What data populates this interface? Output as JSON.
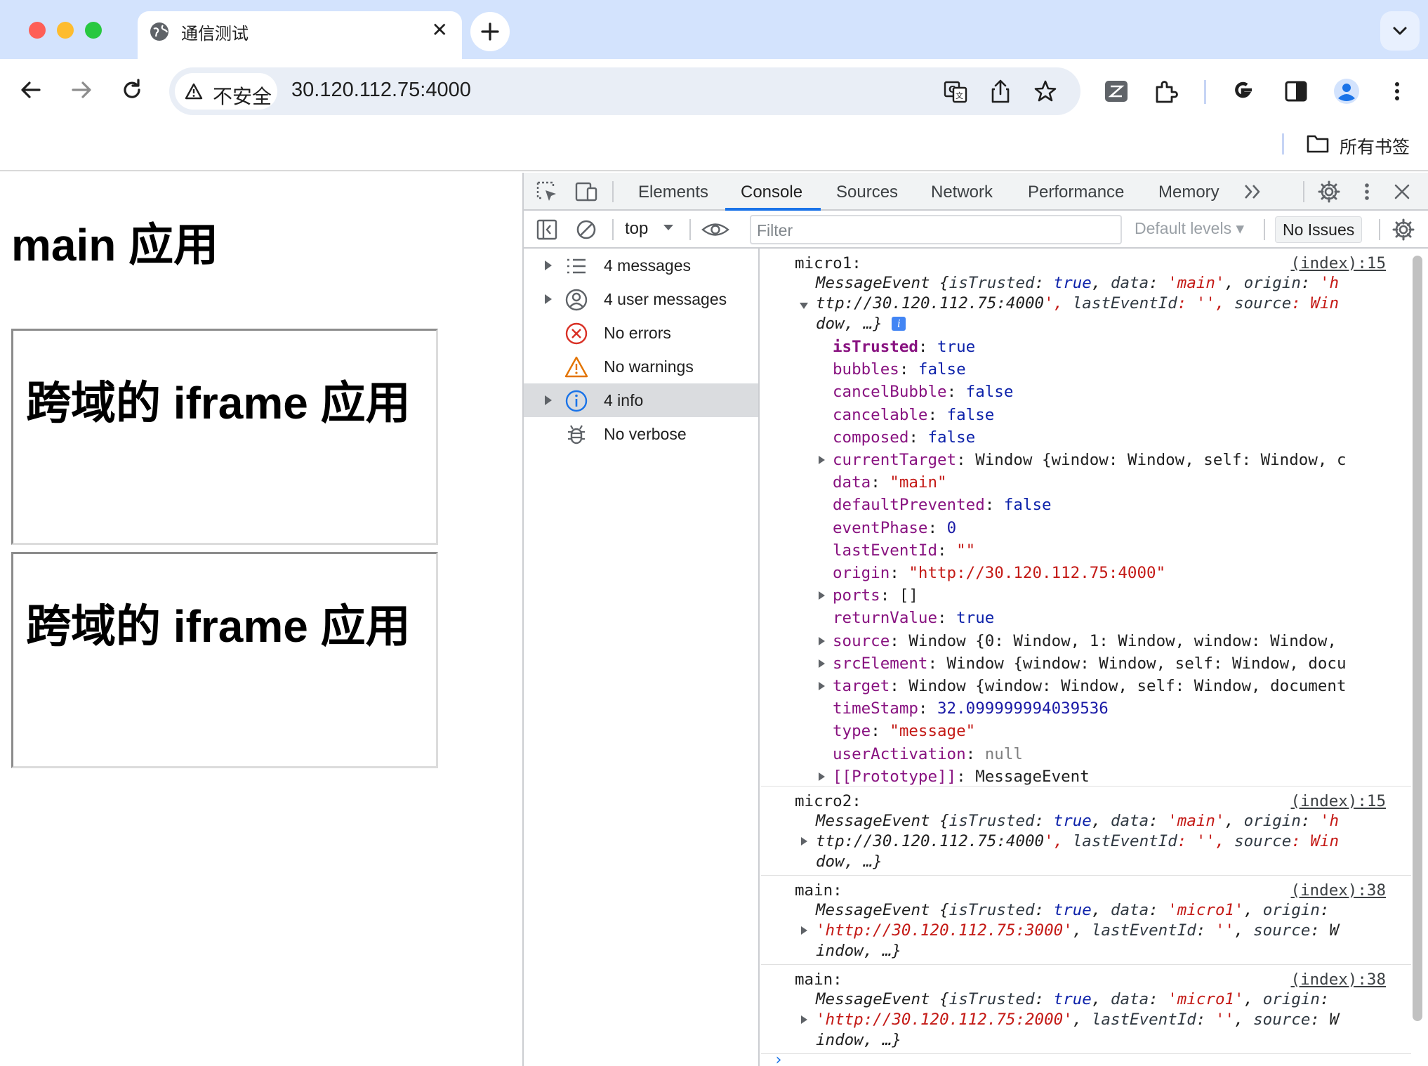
{
  "browser": {
    "tab_title": "通信测试",
    "tab_close": "✕",
    "security_chip": "不安全",
    "url": "30.120.112.75:4000",
    "bookmarks_all": "所有书签"
  },
  "page": {
    "title": "main 应用",
    "iframes": [
      "跨域的 iframe 应用",
      "跨域的 iframe 应用"
    ]
  },
  "devtools": {
    "tabs": [
      "Elements",
      "Console",
      "Sources",
      "Network",
      "Performance",
      "Memory"
    ],
    "active_tab": "Console",
    "context": "top",
    "filter_placeholder": "Filter",
    "levels": "Default levels",
    "issues": "No Issues",
    "sidebar": [
      {
        "label": "4 messages",
        "icon": "list-icon",
        "expandable": true
      },
      {
        "label": "4 user messages",
        "icon": "user-icon",
        "expandable": true
      },
      {
        "label": "No errors",
        "icon": "error-icon",
        "expandable": false
      },
      {
        "label": "No warnings",
        "icon": "warning-icon",
        "expandable": false
      },
      {
        "label": "4 info",
        "icon": "info-icon",
        "expandable": true,
        "selected": true
      },
      {
        "label": "No verbose",
        "icon": "bug-icon",
        "expandable": false
      }
    ],
    "messages": [
      {
        "prefix": "micro1:",
        "source": "(index):15",
        "summary_lines": [
          "MessageEvent {isTrusted: true, data: 'main', origin: 'h",
          "ttp://30.120.112.75:4000', lastEventId: '', source: Win",
          "dow, …}"
        ],
        "expanded": true,
        "properties": [
          {
            "key": "isTrusted",
            "value": "true",
            "bold": true
          },
          {
            "key": "bubbles",
            "value": "false"
          },
          {
            "key": "cancelBubble",
            "value": "false"
          },
          {
            "key": "cancelable",
            "value": "false"
          },
          {
            "key": "composed",
            "value": "false"
          },
          {
            "key": "currentTarget",
            "value": "Window {window: Window, self: Window, c",
            "expandable": true
          },
          {
            "key": "data",
            "value": "\"main\""
          },
          {
            "key": "defaultPrevented",
            "value": "false"
          },
          {
            "key": "eventPhase",
            "value": "0"
          },
          {
            "key": "lastEventId",
            "value": "\"\""
          },
          {
            "key": "origin",
            "value": "\"http://30.120.112.75:4000\""
          },
          {
            "key": "ports",
            "value": "[]",
            "expandable": true
          },
          {
            "key": "returnValue",
            "value": "true"
          },
          {
            "key": "source",
            "value": "Window {0: Window, 1: Window, window: Window,",
            "expandable": true
          },
          {
            "key": "srcElement",
            "value": "Window {window: Window, self: Window, docu",
            "expandable": true
          },
          {
            "key": "target",
            "value": "Window {window: Window, self: Window, document",
            "expandable": true
          },
          {
            "key": "timeStamp",
            "value": "32.099999994039536"
          },
          {
            "key": "type",
            "value": "\"message\""
          },
          {
            "key": "userActivation",
            "value": "null"
          },
          {
            "key": "[[Prototype]]",
            "value": "MessageEvent",
            "expandable": true
          }
        ]
      },
      {
        "prefix": "micro2:",
        "source": "(index):15",
        "summary_lines": [
          "MessageEvent {isTrusted: true, data: 'main', origin: 'h",
          "ttp://30.120.112.75:4000', lastEventId: '', source: Win",
          "dow, …}"
        ]
      },
      {
        "prefix": "main:",
        "source": "(index):38",
        "summary_lines": [
          "MessageEvent {isTrusted: true, data: 'micro1', origin:",
          "'http://30.120.112.75:3000', lastEventId: '', source: W",
          "indow, …}"
        ]
      },
      {
        "prefix": "main:",
        "source": "(index):38",
        "summary_lines": [
          "MessageEvent {isTrusted: true, data: 'micro1', origin:",
          "'http://30.120.112.75:2000', lastEventId: '', source: W",
          "indow, …}"
        ]
      }
    ]
  },
  "colors": {
    "tabstrip": "#d3e3fd",
    "accent": "#1a73e8",
    "key_purple": "#881280",
    "string_red": "#c41a16",
    "keyword_blue": "#0d22aa",
    "number_blue": "#1a1aa6"
  }
}
